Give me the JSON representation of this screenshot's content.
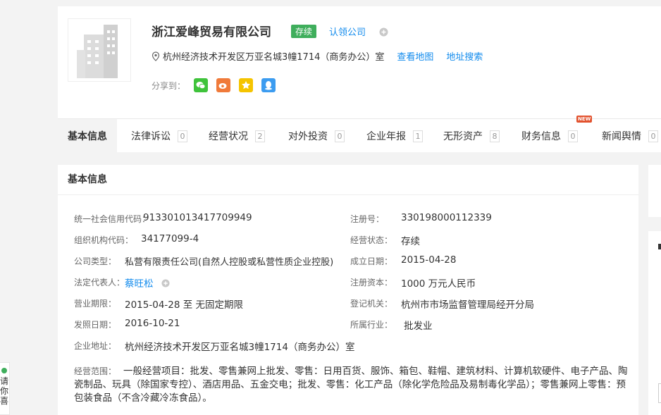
{
  "company": {
    "name": "浙江爱峰贸易有限公司",
    "status": "存续",
    "claim": "认领公司",
    "address": "杭州经济技术开发区万亚名城3幢1714（商务办公）室",
    "view_map": "查看地图",
    "address_search": "地址搜索",
    "share_label": "分享到："
  },
  "tabs": [
    {
      "label": "基本信息",
      "count": ""
    },
    {
      "label": "法律诉讼",
      "count": "0"
    },
    {
      "label": "经营状况",
      "count": "2"
    },
    {
      "label": "对外投资",
      "count": "0"
    },
    {
      "label": "企业年报",
      "count": "1"
    },
    {
      "label": "无形资产",
      "count": "8"
    },
    {
      "label": "财务信息",
      "count": "0"
    },
    {
      "label": "新闻舆情",
      "count": "0"
    }
  ],
  "new_badge": "NEW",
  "panel": {
    "title": "基本信息",
    "fields": {
      "credit_code_label": "统一社会信用代码：",
      "credit_code": "913301013417709949",
      "reg_no_label": "注册号：",
      "reg_no": "330198000112339",
      "org_code_label": "组织机构代码：",
      "org_code": "34177099-4",
      "op_status_label": "经营状态：",
      "op_status": "存续",
      "company_type_label": "公司类型：",
      "company_type": "私营有限责任公司(自然人控股或私营性质企业控股)",
      "found_date_label": "成立日期：",
      "found_date": "2015-04-28",
      "legal_rep_label": "法定代表人：",
      "legal_rep": "蔡旺松",
      "reg_capital_label": "注册资本：",
      "reg_capital": "1000 万元人民币",
      "term_label": "营业期限：",
      "term": "2015-04-28 至 无固定期限",
      "reg_authority_label": "登记机关：",
      "reg_authority": "杭州市市场监督管理局经开分局",
      "issue_date_label": "发照日期：",
      "issue_date": "2016-10-21",
      "industry_label": "所属行业：",
      "industry": "批发业",
      "address_label": "企业地址：",
      "address": "杭州经济技术开发区万亚名城3幢1714（商务办公）室",
      "scope_label": "经营范围：",
      "scope": "一般经营项目：批发、零售兼网上批发、零售：日用百货、服饰、箱包、鞋帽、建筑材料、计算机软硬件、电子产品、陶瓷制品、玩具（除国家专控）、酒店用品、五金交电；批发、零售：化工产品（除化学危险品及易制毒化学品）；零售兼网上零售：预包装食品（不含冷藏冷冻食品）。"
    }
  },
  "left_float": {
    "text": "请你喜"
  },
  "colors": {
    "accent": "#128bed",
    "status_green": "#3fae5c",
    "wechat": "#3fc33b",
    "weibo": "#f07a3a",
    "qzone": "#f5c400",
    "qq": "#3c9cf0"
  }
}
